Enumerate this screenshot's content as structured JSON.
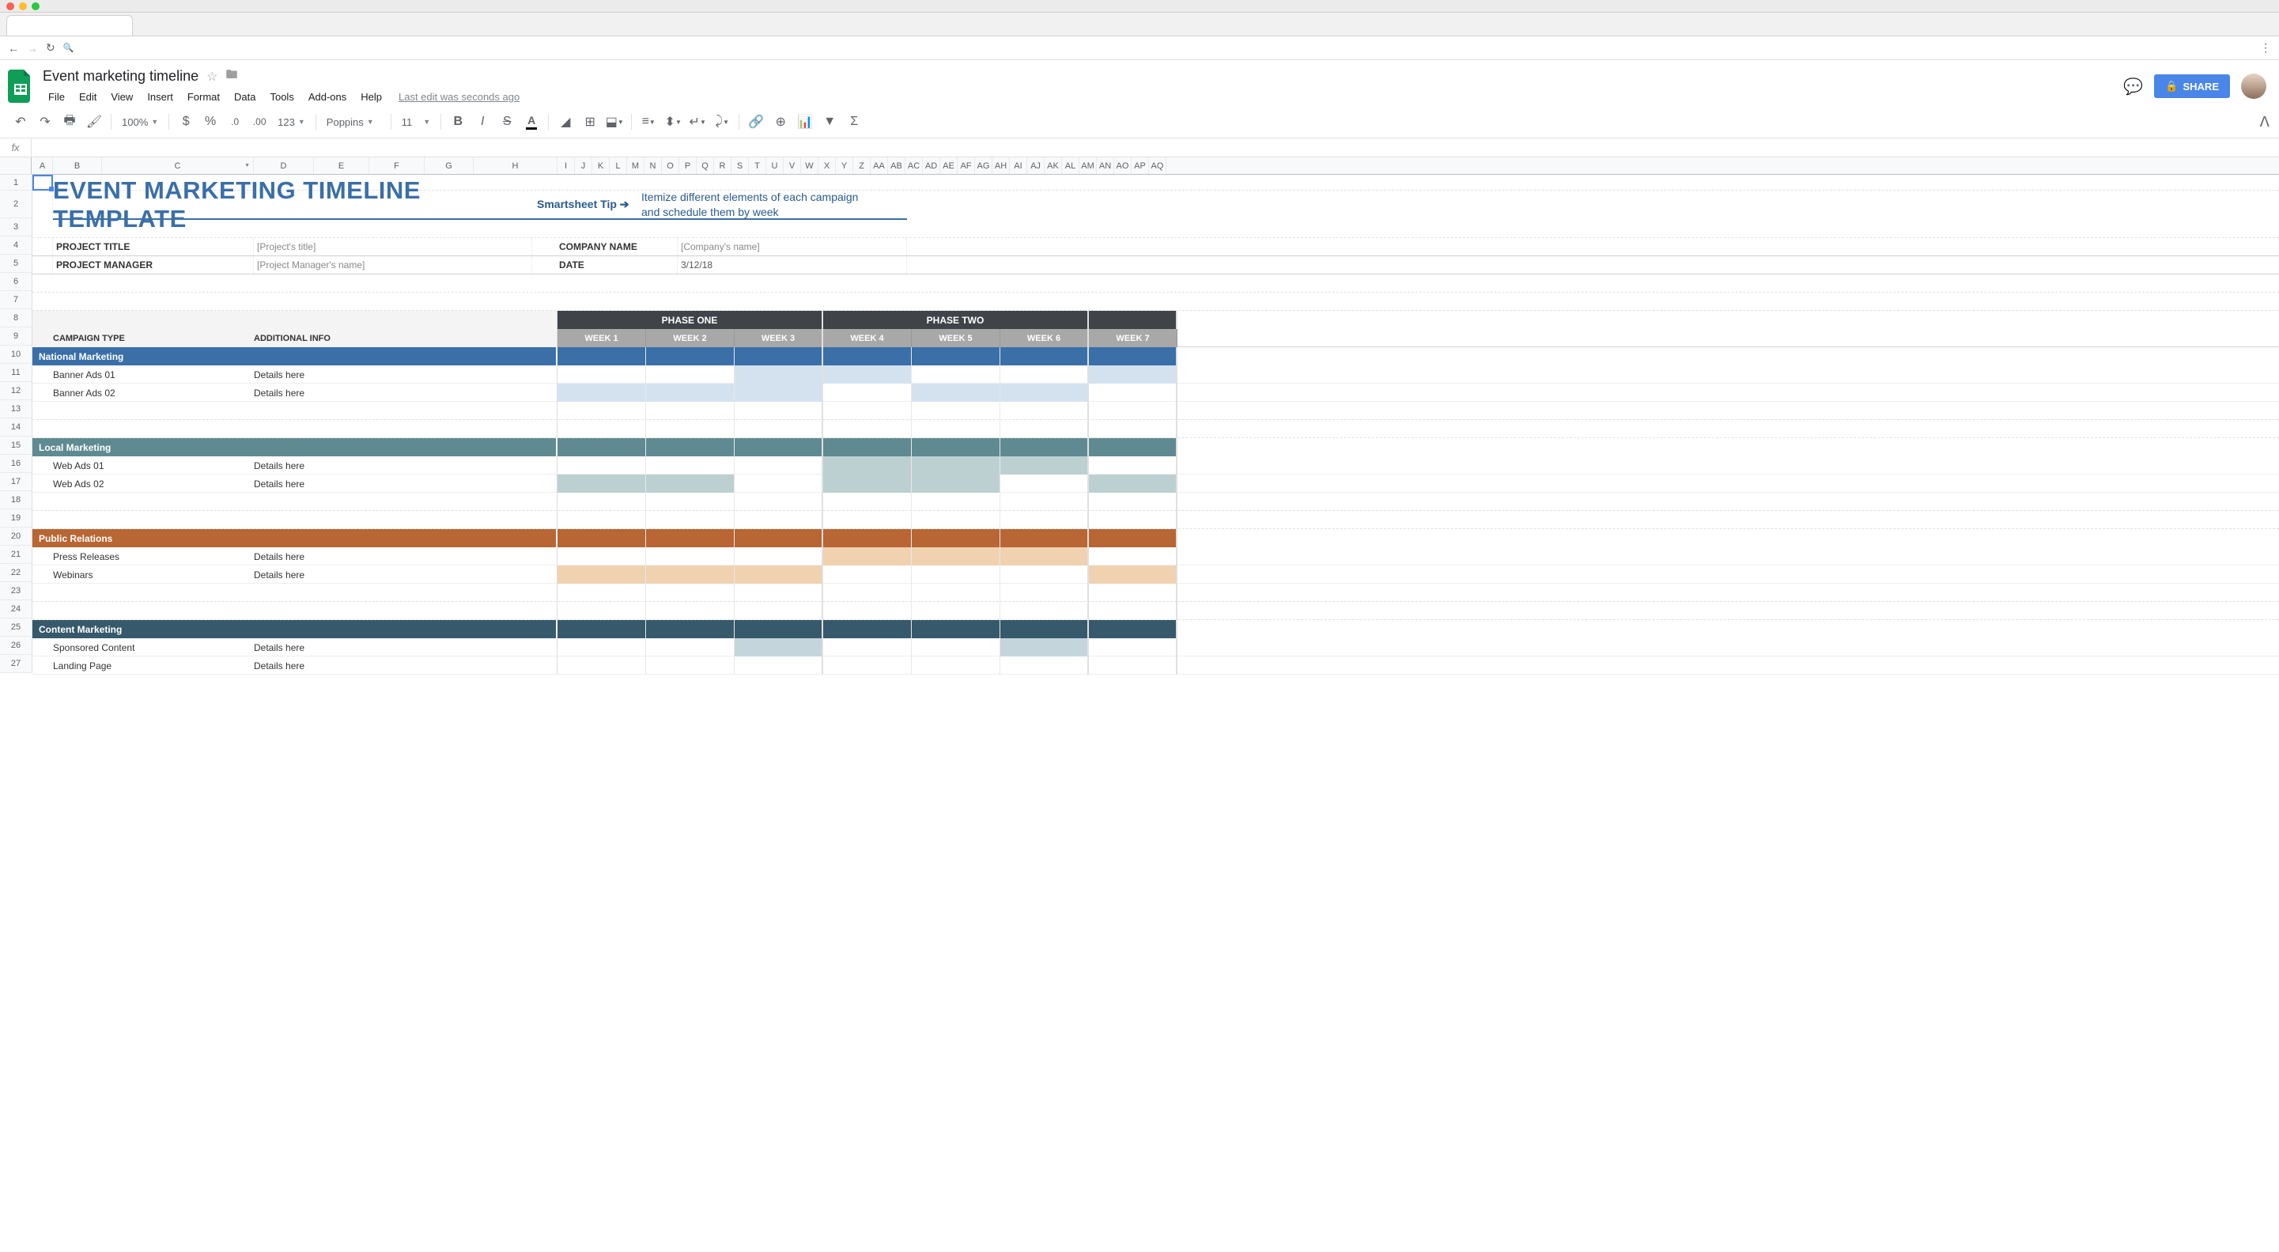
{
  "document": {
    "title": "Event marketing timeline",
    "last_edit": "Last edit was seconds ago"
  },
  "menu": {
    "file": "File",
    "edit": "Edit",
    "view": "View",
    "insert": "Insert",
    "format": "Format",
    "data": "Data",
    "tools": "Tools",
    "addons": "Add-ons",
    "help": "Help"
  },
  "toolbar": {
    "zoom": "100%",
    "font": "Poppins",
    "font_size": "11",
    "num_fmt": "123",
    "share": "SHARE"
  },
  "columns": [
    "A",
    "B",
    "C",
    "D",
    "E",
    "F",
    "G",
    "H",
    "I",
    "J",
    "K",
    "L",
    "M",
    "N",
    "O",
    "P",
    "Q",
    "R",
    "S",
    "T",
    "U",
    "V",
    "W",
    "X",
    "Y",
    "Z",
    "AA",
    "AB",
    "AC",
    "AD",
    "AE",
    "AF",
    "AG",
    "AH",
    "AI",
    "AJ",
    "AK",
    "AL",
    "AM",
    "AN",
    "AO",
    "AP",
    "AQ"
  ],
  "rows": [
    1,
    2,
    3,
    4,
    5,
    6,
    7,
    8,
    9,
    10,
    11,
    12,
    13,
    14,
    15,
    16,
    17,
    18,
    19,
    20,
    21,
    22,
    23,
    24,
    25,
    26,
    27
  ],
  "template": {
    "heading": "EVENT MARKETING TIMELINE TEMPLATE",
    "tip_link": "Smartsheet Tip ➔",
    "tip_text": "Itemize different elements of each campaign and schedule them by week",
    "fields": {
      "project_title_label": "PROJECT TITLE",
      "project_title_value": "[Project's title]",
      "project_manager_label": "PROJECT MANAGER",
      "project_manager_value": "[Project Manager's name]",
      "company_name_label": "COMPANY NAME",
      "company_name_value": "[Company's name]",
      "date_label": "DATE",
      "date_value": "3/12/18"
    },
    "table_headers": {
      "campaign_type": "CAMPAIGN TYPE",
      "additional_info": "ADDITIONAL INFO",
      "phase_one": "PHASE ONE",
      "phase_two": "PHASE TWO",
      "weeks": [
        "WEEK 1",
        "WEEK 2",
        "WEEK 3",
        "WEEK 4",
        "WEEK 5",
        "WEEK 6",
        "WEEK 7"
      ]
    },
    "sections": [
      {
        "title": "National Marketing",
        "class": "sec-navy",
        "fill": "fill-blue",
        "rows": [
          {
            "name": "Banner Ads 01",
            "info": "Details here",
            "weeks": [
              0,
              0,
              1,
              1,
              0,
              0,
              1
            ]
          },
          {
            "name": "Banner Ads 02",
            "info": "Details here",
            "weeks": [
              1,
              1,
              1,
              0,
              1,
              1,
              0
            ]
          }
        ],
        "blank_after": 2
      },
      {
        "title": "Local Marketing",
        "class": "sec-teal",
        "fill": "fill-teal",
        "rows": [
          {
            "name": "Web Ads 01",
            "info": "Details here",
            "weeks": [
              0,
              0,
              0,
              1,
              1,
              1,
              0
            ]
          },
          {
            "name": "Web Ads 02",
            "info": "Details here",
            "weeks": [
              1,
              1,
              0,
              1,
              1,
              0,
              1
            ]
          }
        ],
        "blank_after": 2
      },
      {
        "title": "Public Relations",
        "class": "sec-orange",
        "fill": "fill-orange",
        "rows": [
          {
            "name": "Press Releases",
            "info": "Details here",
            "weeks": [
              0,
              0,
              0,
              1,
              1,
              1,
              0
            ]
          },
          {
            "name": "Webinars",
            "info": "Details here",
            "weeks": [
              1,
              1,
              1,
              0,
              0,
              0,
              1
            ]
          }
        ],
        "blank_after": 2
      },
      {
        "title": "Content Marketing",
        "class": "sec-dark",
        "fill": "fill-dark",
        "rows": [
          {
            "name": "Sponsored Content",
            "info": "Details here",
            "weeks": [
              0,
              0,
              1,
              0,
              0,
              1,
              0
            ]
          },
          {
            "name": "Landing Page",
            "info": "Details here",
            "weeks": [
              0,
              0,
              0,
              0,
              0,
              0,
              0
            ]
          }
        ],
        "blank_after": 0
      }
    ]
  }
}
